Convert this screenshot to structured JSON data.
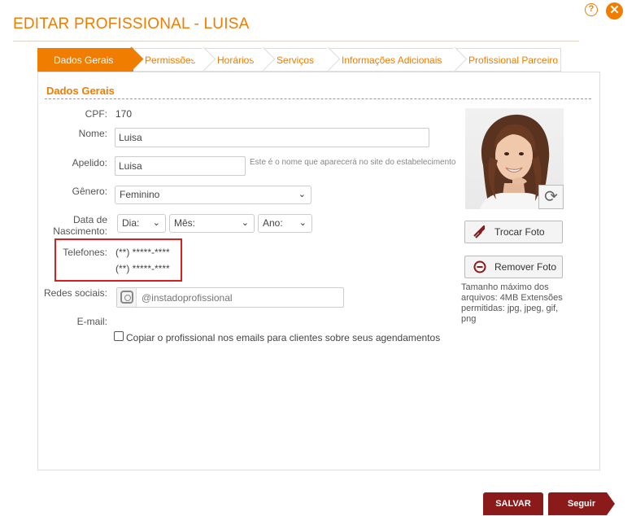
{
  "header": {
    "title": "EDITAR PROFISSIONAL - LUISA",
    "help_symbol": "?",
    "close_symbol": "✕"
  },
  "tabs": [
    {
      "label": "Dados Gerais",
      "active": true
    },
    {
      "label": "Permissões",
      "active": false
    },
    {
      "label": "Horários",
      "active": false
    },
    {
      "label": "Serviços",
      "active": false
    },
    {
      "label": "Informações Adicionais",
      "active": false
    },
    {
      "label": "Profissional Parceiro",
      "active": false
    }
  ],
  "section": {
    "title": "Dados Gerais"
  },
  "form": {
    "cpf": {
      "label": "CPF:",
      "value": "170"
    },
    "nome": {
      "label": "Nome:",
      "value": "Luisa"
    },
    "apelido": {
      "label": "Apelido:",
      "value": "Luisa",
      "hint": "Este é o nome que aparecerá no site do estabelecimento"
    },
    "genero": {
      "label": "Gênero:",
      "value": "Feminino"
    },
    "nascimento": {
      "label_line1": "Data de",
      "label_line2": "Nascimento:",
      "dia": "Dia:",
      "mes": "Mês:",
      "ano": "Ano:"
    },
    "telefones": {
      "label": "Telefones:",
      "values": [
        "(**) *****-****",
        "(**) *****-****"
      ]
    },
    "redes_sociais": {
      "label": "Redes sociais:",
      "placeholder": "@instadoprofissional"
    },
    "email": {
      "label": "E-mail:"
    },
    "copiar_checkbox": {
      "label": "Copiar o profissional nos emails para clientes sobre seus agendamentos",
      "checked": false
    }
  },
  "photo_panel": {
    "trocar_label": "Trocar Foto",
    "remover_label": "Remover Foto",
    "note": "Tamanho máximo dos arquivos: 4MB Extensões permitidas: jpg, jpeg, gif, png"
  },
  "footer": {
    "salvar_label": "SALVAR",
    "seguir_label": "Seguir"
  },
  "colors": {
    "accent": "#f07c00",
    "dark_red": "#8b1a1a",
    "highlight_red": "#d62020"
  }
}
